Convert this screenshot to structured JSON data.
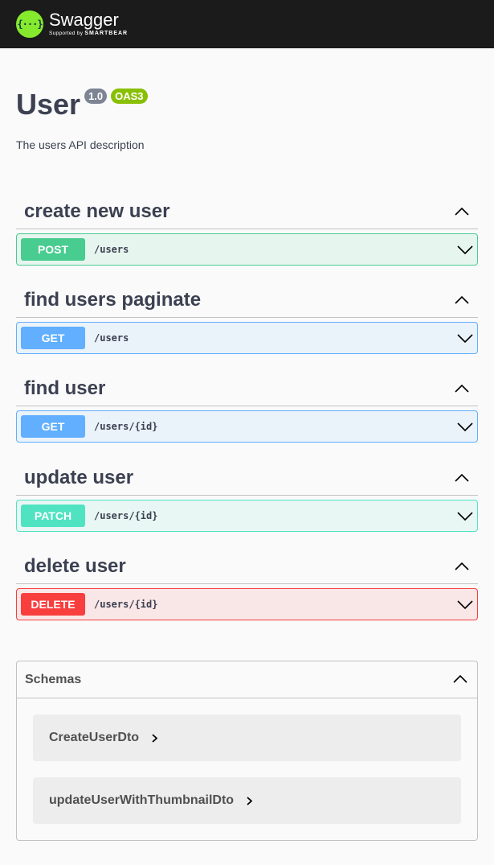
{
  "topbar": {
    "logo_glyph": "{···}",
    "brand": "Swagger",
    "supported_by": "Supported by",
    "company": "SMARTBEAR"
  },
  "info": {
    "title": "User",
    "version": "1.0",
    "oas": "OAS3",
    "description": "The users API description"
  },
  "tags": [
    {
      "name": "create new user",
      "operation": {
        "method": "POST",
        "path": "/users"
      }
    },
    {
      "name": "find users paginate",
      "operation": {
        "method": "GET",
        "path": "/users"
      }
    },
    {
      "name": "find user",
      "operation": {
        "method": "GET",
        "path": "/users/{id}"
      }
    },
    {
      "name": "update user",
      "operation": {
        "method": "PATCH",
        "path": "/users/{id}"
      }
    },
    {
      "name": "delete user",
      "operation": {
        "method": "DELETE",
        "path": "/users/{id}"
      }
    }
  ],
  "schemas": {
    "title": "Schemas",
    "models": [
      "CreateUserDto",
      "updateUserWithThumbnailDto"
    ]
  },
  "colors": {
    "post": "#49cc90",
    "get": "#61affe",
    "patch": "#50e3c2",
    "delete": "#f93e3e",
    "topbar": "#1b1b1b",
    "logo": "#85ea2d",
    "oas_badge": "#89bf04",
    "version_badge": "#7d8492"
  }
}
